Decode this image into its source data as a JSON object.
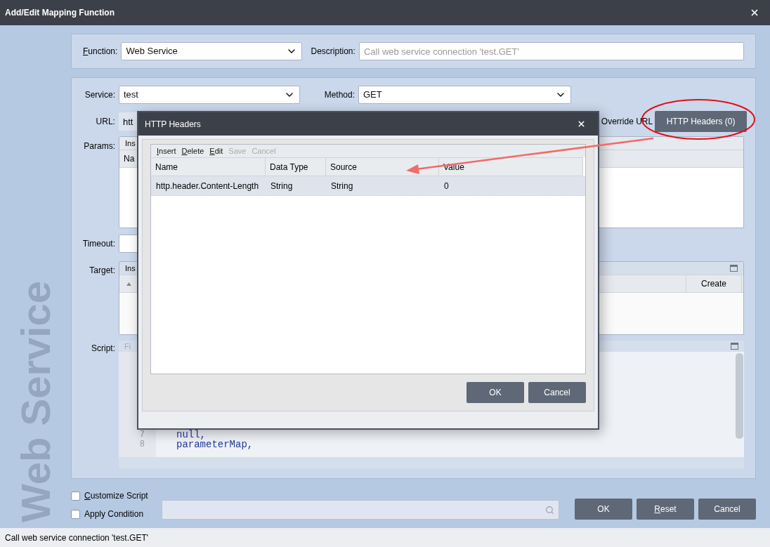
{
  "window": {
    "title": "Add/Edit Mapping Function"
  },
  "side_label": "Web Service",
  "function_panel": {
    "function_label": "Function:",
    "function_label_underline_first": true,
    "function_value": "Web Service",
    "description_label": "Description:",
    "description_placeholder": "Call web service connection 'test.GET'"
  },
  "service_panel": {
    "service_label": "Service:",
    "service_value": "test",
    "method_label": "Method:",
    "method_value": "GET",
    "url_label": "URL:",
    "url_value": "htt",
    "override_label": "Override URL",
    "headers_button": "HTTP Headers (0)",
    "params_label": "Params:",
    "params_toolbar": "Ins",
    "params_column": "Na",
    "timeout_label": "Timeout:",
    "target_label": "Target:",
    "target_toolbar": "Ins",
    "target_column": "Create",
    "script_label": "Script:",
    "script_toolbar": "Fi",
    "code_lines": [
      {
        "number": "7",
        "code": "null,"
      },
      {
        "number": "8",
        "code": "parameterMap,"
      }
    ]
  },
  "options": [
    {
      "label": "Customize Script",
      "underline_first": true,
      "checked": false
    },
    {
      "label": "Apply Condition",
      "underline_first": false,
      "checked": false
    }
  ],
  "buttons": [
    {
      "label": "OK",
      "underline_first": false
    },
    {
      "label": "Reset",
      "underline_first": true
    },
    {
      "label": "Cancel",
      "underline_first": false
    }
  ],
  "status_bar": "Call web service connection 'test.GET'",
  "http_headers_dialog": {
    "title": "HTTP Headers",
    "toolbar": [
      {
        "label": "Insert",
        "disabled": false
      },
      {
        "label": "Delete",
        "disabled": false
      },
      {
        "label": "Edit",
        "disabled": false
      },
      {
        "label": "Save",
        "disabled": true
      },
      {
        "label": "Cancel",
        "disabled": true
      }
    ],
    "columns": [
      "Name",
      "Data Type",
      "Source",
      "Value"
    ],
    "rows": [
      {
        "cells": [
          "http.header.Content-Length",
          "String",
          "String",
          "0"
        ],
        "selected": true
      }
    ],
    "buttons": [
      "OK",
      "Cancel"
    ]
  }
}
